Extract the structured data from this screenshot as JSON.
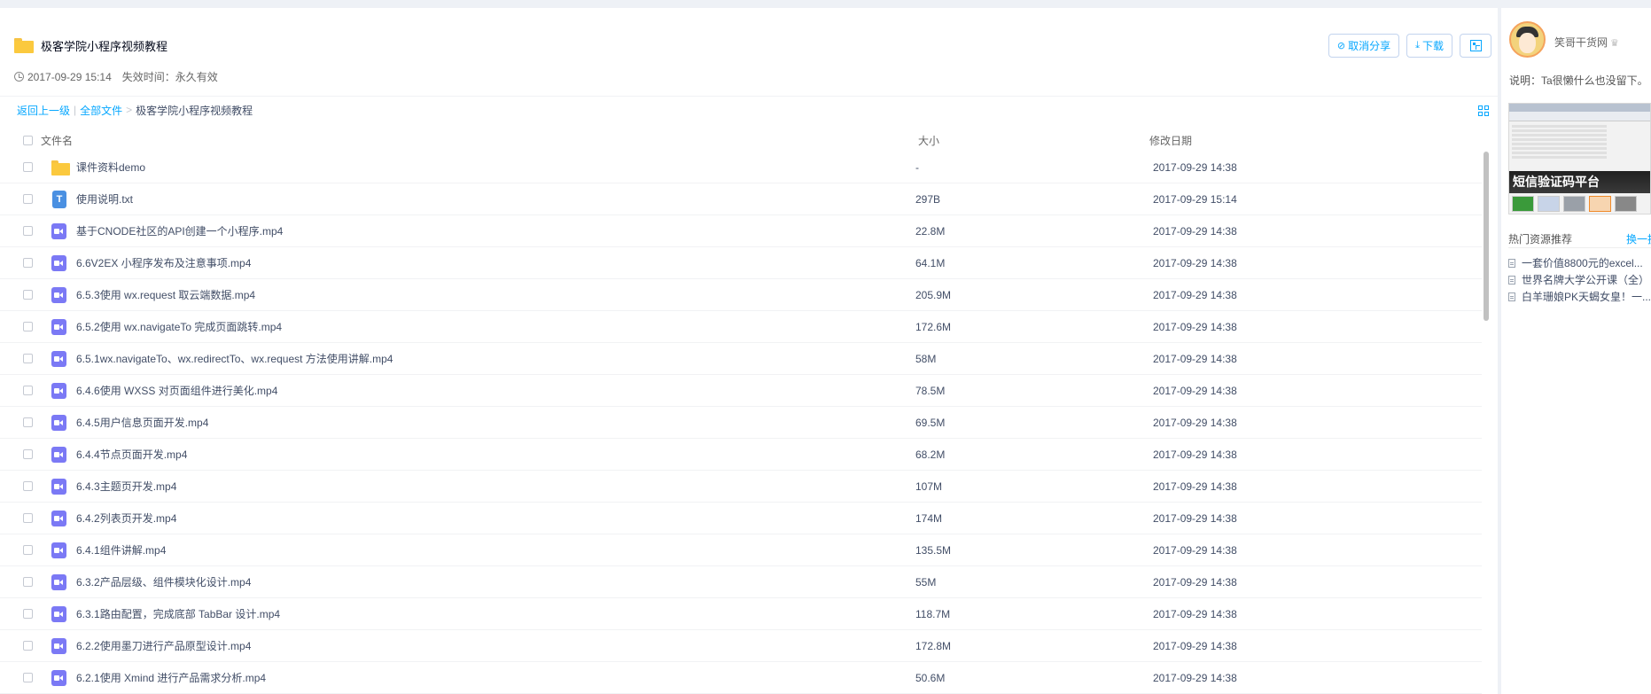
{
  "header": {
    "title": "极客学院小程序视频教程",
    "created": "2017-09-29 15:14",
    "expire": "失效时间：永久有效",
    "cancel_share_label": "取消分享",
    "download_label": "下载"
  },
  "breadcrumb": {
    "back": "返回上一级",
    "all_files": "全部文件",
    "separator": "|",
    "arrow": ">",
    "current": "极客学院小程序视频教程"
  },
  "table": {
    "columns": {
      "name": "文件名",
      "size": "大小",
      "date": "修改日期"
    },
    "rows": [
      {
        "icon": "folder",
        "name": "课件资料demo",
        "size": "-",
        "date": "2017-09-29 14:38"
      },
      {
        "icon": "txt",
        "name": "使用说明.txt",
        "size": "297B",
        "date": "2017-09-29 15:14"
      },
      {
        "icon": "video",
        "name": "基于CNODE社区的API创建一个小程序.mp4",
        "size": "22.8M",
        "date": "2017-09-29 14:38"
      },
      {
        "icon": "video",
        "name": "6.6V2EX 小程序发布及注意事项.mp4",
        "size": "64.1M",
        "date": "2017-09-29 14:38"
      },
      {
        "icon": "video",
        "name": "6.5.3使用 wx.request 取云端数据.mp4",
        "size": "205.9M",
        "date": "2017-09-29 14:38"
      },
      {
        "icon": "video",
        "name": "6.5.2使用 wx.navigateTo 完成页面跳转.mp4",
        "size": "172.6M",
        "date": "2017-09-29 14:38"
      },
      {
        "icon": "video",
        "name": "6.5.1wx.navigateTo、wx.redirectTo、wx.request 方法使用讲解.mp4",
        "size": "58M",
        "date": "2017-09-29 14:38"
      },
      {
        "icon": "video",
        "name": "6.4.6使用 WXSS 对页面组件进行美化.mp4",
        "size": "78.5M",
        "date": "2017-09-29 14:38"
      },
      {
        "icon": "video",
        "name": "6.4.5用户信息页面开发.mp4",
        "size": "69.5M",
        "date": "2017-09-29 14:38"
      },
      {
        "icon": "video",
        "name": "6.4.4节点页面开发.mp4",
        "size": "68.2M",
        "date": "2017-09-29 14:38"
      },
      {
        "icon": "video",
        "name": "6.4.3主题页开发.mp4",
        "size": "107M",
        "date": "2017-09-29 14:38"
      },
      {
        "icon": "video",
        "name": "6.4.2列表页开发.mp4",
        "size": "174M",
        "date": "2017-09-29 14:38"
      },
      {
        "icon": "video",
        "name": "6.4.1组件讲解.mp4",
        "size": "135.5M",
        "date": "2017-09-29 14:38"
      },
      {
        "icon": "video",
        "name": "6.3.2产品层级、组件模块化设计.mp4",
        "size": "55M",
        "date": "2017-09-29 14:38"
      },
      {
        "icon": "video",
        "name": "6.3.1路由配置，完成底部 TabBar 设计.mp4",
        "size": "118.7M",
        "date": "2017-09-29 14:38"
      },
      {
        "icon": "video",
        "name": "6.2.2使用墨刀进行产品原型设计.mp4",
        "size": "172.8M",
        "date": "2017-09-29 14:38"
      },
      {
        "icon": "video",
        "name": "6.2.1使用 Xmind 进行产品需求分析.mp4",
        "size": "50.6M",
        "date": "2017-09-29 14:38"
      }
    ]
  },
  "sidebar": {
    "username": "笑哥干货网",
    "description": "说明：Ta很懒什么也没留下。",
    "promo_text": "短信验证码平台",
    "hot_title": "热门资源推荐",
    "hot_swap": "换一换",
    "hot_items": [
      "一套价值8800元的excel...",
      "世界名牌大学公开课（全）",
      "白羊珊娘PK天蝎女皇！一..."
    ]
  },
  "colors": {
    "accent": "#06a7ff",
    "folder": "#fbc93e",
    "video_icon": "#7b79f5",
    "txt_icon": "#4a90e2",
    "page_bg": "#eef1f6"
  }
}
